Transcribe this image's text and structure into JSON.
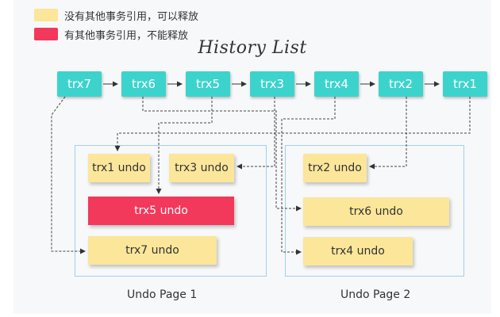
{
  "legend": [
    {
      "text": "没有其他事务引用，可以释放",
      "color": "#fbe69a"
    },
    {
      "text": "有其他事务引用，不能释放",
      "color": "#f2385b"
    }
  ],
  "title": "History List",
  "colors": {
    "node": "#3dd3cd",
    "page_border": "#9fd1ea",
    "free": "#fbe69a",
    "in_use": "#f2385b"
  },
  "history": [
    "trx7",
    "trx6",
    "trx5",
    "trx3",
    "trx4",
    "trx2",
    "trx1"
  ],
  "pages": [
    {
      "label": "Undo Page 1"
    },
    {
      "label": "Undo Page 2"
    }
  ],
  "undo": [
    {
      "id": "trx1",
      "text": "trx1 undo",
      "state": "free"
    },
    {
      "id": "trx3",
      "text": "trx3 undo",
      "state": "free"
    },
    {
      "id": "trx5",
      "text": "trx5 undo",
      "state": "in_use"
    },
    {
      "id": "trx7",
      "text": "trx7 undo",
      "state": "free"
    },
    {
      "id": "trx2",
      "text": "trx2 undo",
      "state": "free"
    },
    {
      "id": "trx6",
      "text": "trx6 undo",
      "state": "free"
    },
    {
      "id": "trx4",
      "text": "trx4 undo",
      "state": "free"
    }
  ]
}
